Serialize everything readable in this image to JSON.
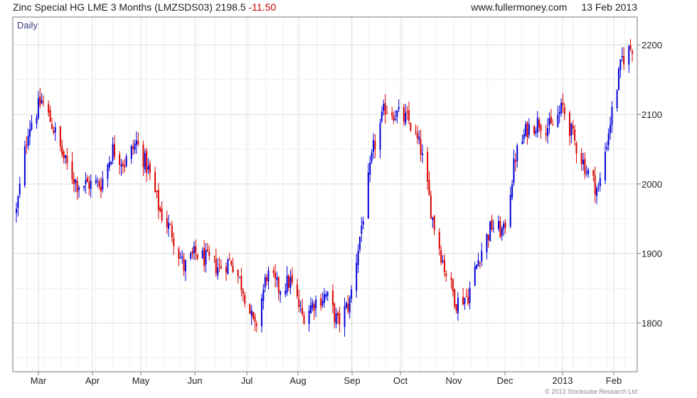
{
  "header": {
    "instrument": "Zinc Special HG LME 3 Months (LMZSDS03)",
    "price": "2198.5",
    "change": "-11.50",
    "site": "www.fullermoney.com",
    "date": "13 Feb 2013"
  },
  "copyright": "© 2013 Stockcube Research Ltd",
  "colors": {
    "up": "#0000dd",
    "down": "#dd0000",
    "grid": "#dcdcdc",
    "frame": "#777777",
    "label": "#3a3a8a"
  },
  "chart_data": {
    "type": "ohlc",
    "period_label": "Daily",
    "ylim": [
      1730,
      2240
    ],
    "y_ticks": [
      1800,
      1900,
      2000,
      2100,
      2200
    ],
    "x_ticks": [
      "Mar",
      "Apr",
      "May",
      "Jun",
      "Jul",
      "Aug",
      "Sep",
      "Oct",
      "Nov",
      "Dec",
      "2013",
      "Feb"
    ],
    "grid": true,
    "y_axis_side": "right",
    "x_range": [
      "2012-02-15",
      "2013-02-13"
    ],
    "series": [
      {
        "x": [
          "2012-02-15",
          "2012-02-22",
          "2012-03-01",
          "2012-03-08",
          "2012-03-15",
          "2012-03-22",
          "2012-03-29",
          "2012-04-05",
          "2012-04-12",
          "2012-04-19",
          "2012-04-26",
          "2012-05-03",
          "2012-05-10",
          "2012-05-17",
          "2012-05-24",
          "2012-05-31",
          "2012-06-07",
          "2012-06-14",
          "2012-06-21",
          "2012-06-28",
          "2012-07-05",
          "2012-07-12",
          "2012-07-19",
          "2012-07-26",
          "2012-08-02",
          "2012-08-09",
          "2012-08-16",
          "2012-08-23",
          "2012-08-30",
          "2012-09-06",
          "2012-09-13",
          "2012-09-20",
          "2012-09-27",
          "2012-10-04",
          "2012-10-11",
          "2012-10-18",
          "2012-10-25",
          "2012-11-01",
          "2012-11-08",
          "2012-11-15",
          "2012-11-22",
          "2012-11-29",
          "2012-12-06",
          "2012-12-13",
          "2012-12-20",
          "2012-12-27",
          "2013-01-03",
          "2013-01-10",
          "2013-01-17",
          "2013-01-24",
          "2013-01-31",
          "2013-02-07",
          "2013-02-13"
        ],
        "y": [
          1960,
          2080,
          2120,
          2080,
          2030,
          2000,
          2000,
          2000,
          2050,
          2030,
          2060,
          2020,
          1960,
          1930,
          1880,
          1900,
          1890,
          1880,
          1890,
          1850,
          1790,
          1870,
          1850,
          1860,
          1810,
          1830,
          1840,
          1800,
          1830,
          1940,
          2050,
          2110,
          2100,
          2090,
          2050,
          1950,
          1880,
          1830,
          1840,
          1900,
          1940,
          1930,
          2040,
          2080,
          2090,
          2080,
          2110,
          2060,
          2020,
          1990,
          2090,
          2180,
          2198.5
        ]
      }
    ]
  }
}
